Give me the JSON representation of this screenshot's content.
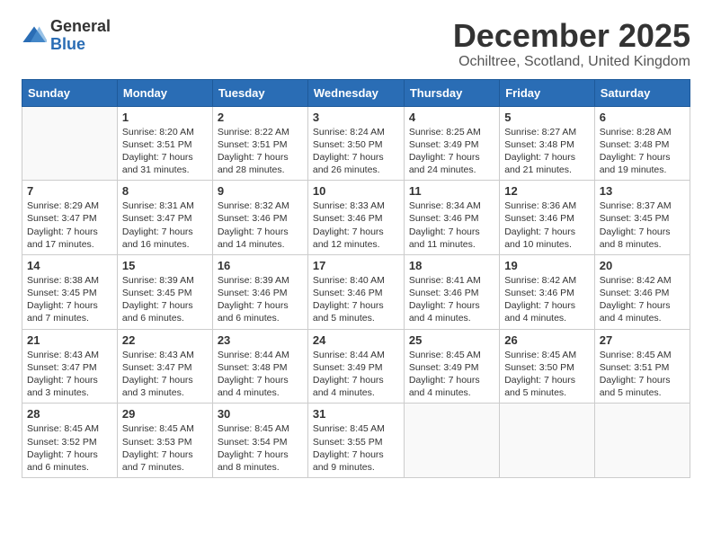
{
  "logo": {
    "general": "General",
    "blue": "Blue"
  },
  "title": "December 2025",
  "subtitle": "Ochiltree, Scotland, United Kingdom",
  "days_of_week": [
    "Sunday",
    "Monday",
    "Tuesday",
    "Wednesday",
    "Thursday",
    "Friday",
    "Saturday"
  ],
  "weeks": [
    [
      {
        "day": "",
        "info": ""
      },
      {
        "day": "1",
        "info": "Sunrise: 8:20 AM\nSunset: 3:51 PM\nDaylight: 7 hours\nand 31 minutes."
      },
      {
        "day": "2",
        "info": "Sunrise: 8:22 AM\nSunset: 3:51 PM\nDaylight: 7 hours\nand 28 minutes."
      },
      {
        "day": "3",
        "info": "Sunrise: 8:24 AM\nSunset: 3:50 PM\nDaylight: 7 hours\nand 26 minutes."
      },
      {
        "day": "4",
        "info": "Sunrise: 8:25 AM\nSunset: 3:49 PM\nDaylight: 7 hours\nand 24 minutes."
      },
      {
        "day": "5",
        "info": "Sunrise: 8:27 AM\nSunset: 3:48 PM\nDaylight: 7 hours\nand 21 minutes."
      },
      {
        "day": "6",
        "info": "Sunrise: 8:28 AM\nSunset: 3:48 PM\nDaylight: 7 hours\nand 19 minutes."
      }
    ],
    [
      {
        "day": "7",
        "info": "Sunrise: 8:29 AM\nSunset: 3:47 PM\nDaylight: 7 hours\nand 17 minutes."
      },
      {
        "day": "8",
        "info": "Sunrise: 8:31 AM\nSunset: 3:47 PM\nDaylight: 7 hours\nand 16 minutes."
      },
      {
        "day": "9",
        "info": "Sunrise: 8:32 AM\nSunset: 3:46 PM\nDaylight: 7 hours\nand 14 minutes."
      },
      {
        "day": "10",
        "info": "Sunrise: 8:33 AM\nSunset: 3:46 PM\nDaylight: 7 hours\nand 12 minutes."
      },
      {
        "day": "11",
        "info": "Sunrise: 8:34 AM\nSunset: 3:46 PM\nDaylight: 7 hours\nand 11 minutes."
      },
      {
        "day": "12",
        "info": "Sunrise: 8:36 AM\nSunset: 3:46 PM\nDaylight: 7 hours\nand 10 minutes."
      },
      {
        "day": "13",
        "info": "Sunrise: 8:37 AM\nSunset: 3:45 PM\nDaylight: 7 hours\nand 8 minutes."
      }
    ],
    [
      {
        "day": "14",
        "info": "Sunrise: 8:38 AM\nSunset: 3:45 PM\nDaylight: 7 hours\nand 7 minutes."
      },
      {
        "day": "15",
        "info": "Sunrise: 8:39 AM\nSunset: 3:45 PM\nDaylight: 7 hours\nand 6 minutes."
      },
      {
        "day": "16",
        "info": "Sunrise: 8:39 AM\nSunset: 3:46 PM\nDaylight: 7 hours\nand 6 minutes."
      },
      {
        "day": "17",
        "info": "Sunrise: 8:40 AM\nSunset: 3:46 PM\nDaylight: 7 hours\nand 5 minutes."
      },
      {
        "day": "18",
        "info": "Sunrise: 8:41 AM\nSunset: 3:46 PM\nDaylight: 7 hours\nand 4 minutes."
      },
      {
        "day": "19",
        "info": "Sunrise: 8:42 AM\nSunset: 3:46 PM\nDaylight: 7 hours\nand 4 minutes."
      },
      {
        "day": "20",
        "info": "Sunrise: 8:42 AM\nSunset: 3:46 PM\nDaylight: 7 hours\nand 4 minutes."
      }
    ],
    [
      {
        "day": "21",
        "info": "Sunrise: 8:43 AM\nSunset: 3:47 PM\nDaylight: 7 hours\nand 3 minutes."
      },
      {
        "day": "22",
        "info": "Sunrise: 8:43 AM\nSunset: 3:47 PM\nDaylight: 7 hours\nand 3 minutes."
      },
      {
        "day": "23",
        "info": "Sunrise: 8:44 AM\nSunset: 3:48 PM\nDaylight: 7 hours\nand 4 minutes."
      },
      {
        "day": "24",
        "info": "Sunrise: 8:44 AM\nSunset: 3:49 PM\nDaylight: 7 hours\nand 4 minutes."
      },
      {
        "day": "25",
        "info": "Sunrise: 8:45 AM\nSunset: 3:49 PM\nDaylight: 7 hours\nand 4 minutes."
      },
      {
        "day": "26",
        "info": "Sunrise: 8:45 AM\nSunset: 3:50 PM\nDaylight: 7 hours\nand 5 minutes."
      },
      {
        "day": "27",
        "info": "Sunrise: 8:45 AM\nSunset: 3:51 PM\nDaylight: 7 hours\nand 5 minutes."
      }
    ],
    [
      {
        "day": "28",
        "info": "Sunrise: 8:45 AM\nSunset: 3:52 PM\nDaylight: 7 hours\nand 6 minutes."
      },
      {
        "day": "29",
        "info": "Sunrise: 8:45 AM\nSunset: 3:53 PM\nDaylight: 7 hours\nand 7 minutes."
      },
      {
        "day": "30",
        "info": "Sunrise: 8:45 AM\nSunset: 3:54 PM\nDaylight: 7 hours\nand 8 minutes."
      },
      {
        "day": "31",
        "info": "Sunrise: 8:45 AM\nSunset: 3:55 PM\nDaylight: 7 hours\nand 9 minutes."
      },
      {
        "day": "",
        "info": ""
      },
      {
        "day": "",
        "info": ""
      },
      {
        "day": "",
        "info": ""
      }
    ]
  ]
}
